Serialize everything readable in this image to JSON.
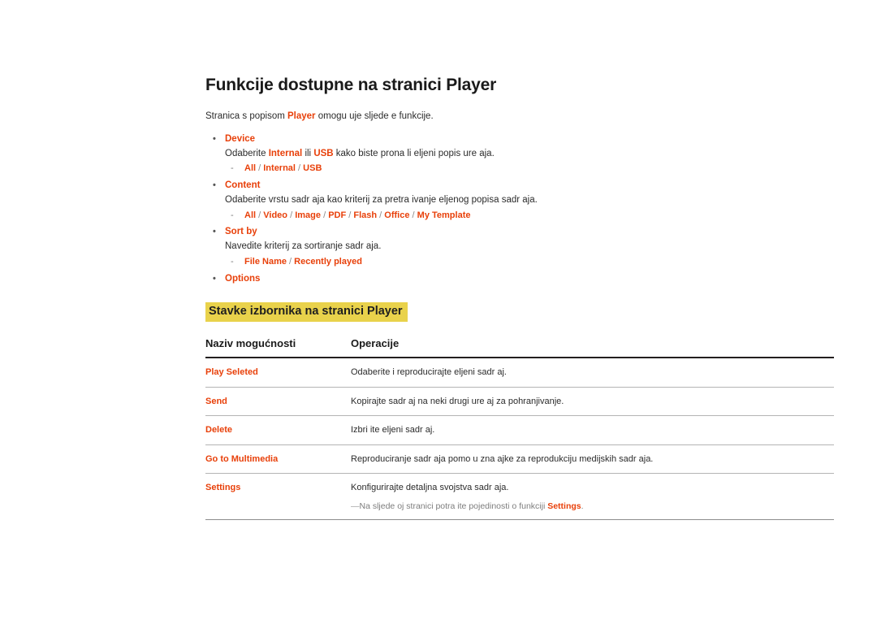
{
  "document": {
    "title": "Funkcije dostupne na stranici Player",
    "intro": {
      "before": "Stranica s popisom ",
      "accent": "Player",
      "after": " omogu uje sljede e funkcije."
    },
    "bullet_marker": "•",
    "sub_marker": "-",
    "separator": "/",
    "bullets": [
      {
        "name": "Device",
        "desc_parts": [
          {
            "text": "Odaberite ",
            "style": "plain"
          },
          {
            "text": "Internal",
            "style": "accent"
          },
          {
            "text": " ili ",
            "style": "plain"
          },
          {
            "text": "USB",
            "style": "accent"
          },
          {
            "text": " kako biste prona li  eljeni popis ure aja.",
            "style": "plain"
          }
        ],
        "options": [
          "All",
          "Internal",
          "USB"
        ]
      },
      {
        "name": "Content",
        "desc_parts": [
          {
            "text": "Odaberite vrstu sadr aja kao kriterij za pretra ivanje  eljenog popisa sadr aja.",
            "style": "plain"
          }
        ],
        "options": [
          "All",
          "Video",
          "Image",
          "PDF",
          "Flash",
          "Office",
          "My Template"
        ]
      },
      {
        "name": "Sort by",
        "desc_parts": [
          {
            "text": "Navedite kriterij za sortiranje sadr aja.",
            "style": "plain"
          }
        ],
        "options": [
          "File Name",
          "Recently played"
        ]
      },
      {
        "name": "Options",
        "desc_parts": [],
        "options": []
      }
    ],
    "section_heading": "Stavke izbornika na stranici Player",
    "table": {
      "headers": [
        "Naziv mogućnosti",
        "Operacije"
      ],
      "rows": [
        {
          "name": "Play Seleted",
          "desc": "Odaberite i reproducirajte  eljeni sadr aj."
        },
        {
          "name": "Send",
          "desc": "Kopirajte sadr aj na neki drugi ure aj za pohranjivanje."
        },
        {
          "name": "Delete",
          "desc": "Izbri ite  eljeni sadr aj."
        },
        {
          "name": "Go to Multimedia",
          "desc": "Reproduciranje sadr aja pomo u zna ajke za reprodukciju medijskih sadr aja."
        },
        {
          "name": "Settings",
          "desc": "Konfigurirajte detaljna svojstva sadr aja.",
          "note": {
            "lead_dash": "―",
            "before": "Na sljede oj stranici potra ite pojedinosti o funkciji ",
            "accent": "Settings",
            "after": "."
          }
        }
      ]
    }
  },
  "colors": {
    "accent": "#E8400A",
    "highlight": "#E9D24B",
    "text": "#2b2b2b",
    "rule_dark": "#231f20",
    "rule_light": "#b4b4b4"
  }
}
